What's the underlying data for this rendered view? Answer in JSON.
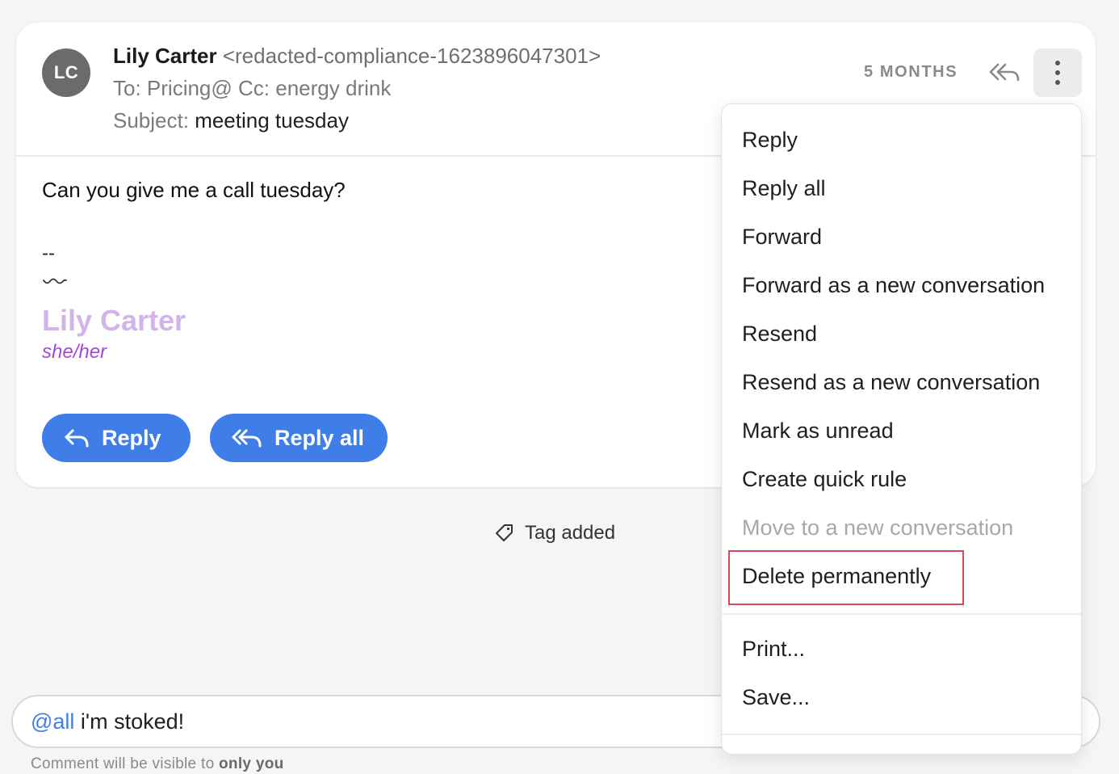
{
  "email": {
    "avatar_initials": "LC",
    "sender_name": "Lily Carter",
    "sender_email": "<redacted-compliance-1623896047301>",
    "to_label": "To:",
    "to_value": "Pricing@",
    "cc_label": "Cc:",
    "cc_value": "energy drink",
    "subject_label": "Subject:",
    "subject_value": "meeting tuesday",
    "age": "5 MONTHS",
    "body": "Can you give me a call tuesday?",
    "signature": {
      "dash": "--",
      "name": "Lily Carter",
      "pronouns": "she/her"
    },
    "reply_button": "Reply",
    "reply_all_button": "Reply all"
  },
  "activity": {
    "tag_added": "Tag added"
  },
  "comment": {
    "mention": "@all",
    "text": " i'm stoked!",
    "visibility_prefix": "Comment will be visible to",
    "visibility_target": "only you"
  },
  "context_menu": {
    "items": [
      {
        "label": "Reply"
      },
      {
        "label": "Reply all"
      },
      {
        "label": "Forward"
      },
      {
        "label": "Forward as a new conversation"
      },
      {
        "label": "Resend"
      },
      {
        "label": "Resend as a new conversation"
      },
      {
        "label": "Mark as unread"
      },
      {
        "label": "Create quick rule"
      },
      {
        "label": "Move to a new conversation",
        "disabled": true
      },
      {
        "label": "Delete permanently",
        "highlighted": true
      },
      {
        "label": "Print..."
      },
      {
        "label": "Save..."
      }
    ]
  },
  "colors": {
    "accent": "#3f7ee8",
    "highlight_border": "#d9455a",
    "signature_name": "#d2b4ea",
    "signature_pronouns": "#a24ad6"
  }
}
